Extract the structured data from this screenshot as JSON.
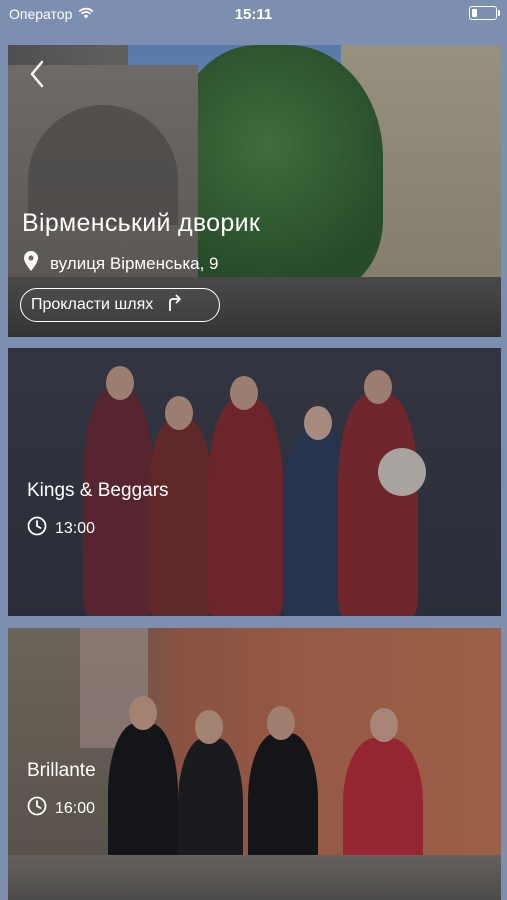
{
  "status": {
    "carrier": "Оператор",
    "time": "15:11"
  },
  "hero": {
    "title": "Вірменський дворик",
    "address": "вулиця Вірменська, 9",
    "route_label": "Прокласти шлях"
  },
  "events": [
    {
      "title": "Kings & Beggars",
      "time": "13:00"
    },
    {
      "title": "Brillante",
      "time": "16:00"
    }
  ],
  "icons": {
    "back": "chevron-left-icon",
    "location": "location-pin-icon",
    "route": "turn-right-icon",
    "clock": "clock-icon",
    "wifi": "wifi-icon",
    "battery": "battery-icon"
  },
  "colors": {
    "background": "#7d8fb0",
    "text": "#ffffff"
  }
}
